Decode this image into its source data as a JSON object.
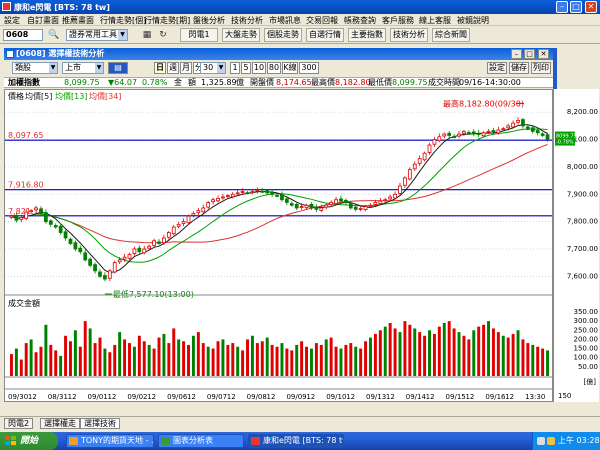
{
  "window": {
    "title": "康和e閃電 [BTS: 78 tw]"
  },
  "menu": [
    "設定",
    "自訂畫面",
    "推薦畫面",
    "行情走勢[個]",
    "行情走勢[期]",
    "盤後分析",
    "技術分析",
    "市場訊息",
    "交易回報",
    "帳務查詢",
    "客戶服務",
    "線上客服",
    "被鏡說明"
  ],
  "toolbar": {
    "stock_code": "0608",
    "tool_select": "證券常用工具",
    "buttons": [
      "閃電1",
      "大盤走勢",
      "個股走勢",
      "自選行情",
      "主要指數",
      "技術分析",
      "綜合新聞"
    ]
  },
  "doc": {
    "title": "[0608] 選擇權技術分析"
  },
  "controls": {
    "category": "類股",
    "market": "上市",
    "period_buttons": [
      "日",
      "週",
      "月",
      "分"
    ],
    "active_period": "日",
    "interval": "30",
    "ranges": [
      "1",
      "5",
      "10",
      "80"
    ],
    "k_label": "K線",
    "count": "300",
    "right_buttons": [
      "設定",
      "儲存",
      "列印"
    ]
  },
  "info": {
    "name": "加權指數",
    "price": "8,099.75",
    "change": "▼64.07",
    "change_pct": "0.78%",
    "amount_label": "金",
    "amount": "額",
    "amount_value": "1,325.89",
    "amount_unit": "億",
    "open_label": "開盤價",
    "open": "8,174.65",
    "high_label": "最高價",
    "high": "8,182.80",
    "low_label": "最低價",
    "low": "8,099.75",
    "time_label": "成交時間",
    "time": "09/16-14:30:00"
  },
  "legend": {
    "price": "價格",
    "ma1": "均價[5]",
    "ma2": "均價[13]",
    "ma3": "均價[34]"
  },
  "colors": {
    "ma5": "#1a1a1a",
    "ma13": "#00a000",
    "ma34": "#e03030",
    "up": "#e00000",
    "down": "#008000",
    "hline": "#0000c0"
  },
  "annotations": {
    "high": "最高8,182.80(09/30)",
    "low": "最低7,577.10(13:00)"
  },
  "hlines": [
    {
      "label": "8,097.65",
      "value": 8097.65
    },
    {
      "label": "7,916.80",
      "value": 7916.8
    },
    {
      "label": "7,821.16",
      "value": 7821.16
    }
  ],
  "price_axis": [
    "8,200.00",
    "8,100.00",
    "8,000.00",
    "7,900.00",
    "7,800.00",
    "7,700.00",
    "7,600.00"
  ],
  "current_price_badge": [
    "8099.75",
    "-0.78%"
  ],
  "volume": {
    "title": "成交金額",
    "axis": [
      "350.00",
      "300.00",
      "250.00",
      "200.00",
      "150.00",
      "100.00",
      "50.00"
    ],
    "unit": "[億]"
  },
  "date_axis": [
    "09/30",
    "12",
    "08/31",
    "12",
    "09/01",
    "12",
    "09/02",
    "12",
    "09/06",
    "12",
    "09/07",
    "12",
    "09/08",
    "12",
    "09/09",
    "12",
    "09/10",
    "12",
    "09/13",
    "12",
    "09/14",
    "12",
    "09/15",
    "12",
    "09/16",
    "12",
    "13:30"
  ],
  "zoom": "150",
  "tabs": [
    "閃電2",
    "選擇權走",
    "選擇技術"
  ],
  "taskbar": {
    "start": "開始",
    "items": [
      "TONY的期貨天地 - ...",
      "圖表分析表",
      "康和e閃電 [BTS: 78 tw]"
    ],
    "clock": "上午 03:28"
  },
  "chart_data": {
    "type": "candlestick",
    "title": "加權指數",
    "ylim": [
      7550,
      8230
    ],
    "x_ticks": [
      "09/30",
      "08/31",
      "09/01",
      "09/02",
      "09/06",
      "09/07",
      "09/08",
      "09/09",
      "09/10",
      "09/13",
      "09/14",
      "09/15",
      "09/16"
    ],
    "close": [
      7820,
      7805,
      7815,
      7835,
      7840,
      7850,
      7830,
      7800,
      7790,
      7780,
      7760,
      7740,
      7720,
      7700,
      7690,
      7660,
      7640,
      7620,
      7600,
      7590,
      7620,
      7650,
      7660,
      7670,
      7680,
      7700,
      7690,
      7700,
      7710,
      7730,
      7720,
      7740,
      7760,
      7780,
      7790,
      7800,
      7820,
      7830,
      7840,
      7850,
      7870,
      7880,
      7885,
      7890,
      7895,
      7900,
      7905,
      7910,
      7905,
      7910,
      7915,
      7910,
      7905,
      7900,
      7895,
      7880,
      7870,
      7860,
      7850,
      7855,
      7860,
      7850,
      7845,
      7850,
      7860,
      7870,
      7880,
      7875,
      7870,
      7850,
      7845,
      7848,
      7855,
      7860,
      7870,
      7875,
      7880,
      7890,
      7900,
      7930,
      7960,
      7990,
      8010,
      8030,
      8050,
      8080,
      8100,
      8110,
      8120,
      8115,
      8110,
      8120,
      8130,
      8125,
      8120,
      8118,
      8125,
      8130,
      8128,
      8135,
      8140,
      8150,
      8160,
      8170,
      8150,
      8140,
      8130,
      8125,
      8115,
      8100
    ],
    "volume_range": [
      0,
      350
    ],
    "volume_sample": [
      120,
      150,
      90,
      180,
      200,
      130,
      160,
      280,
      170,
      140,
      110,
      220,
      190,
      250,
      160,
      300,
      260,
      180,
      210,
      150,
      130,
      170,
      240,
      200,
      180,
      160,
      220,
      190,
      170,
      150,
      210,
      230,
      180,
      260,
      200,
      190,
      170,
      220,
      240,
      180,
      160,
      150,
      190,
      200,
      170,
      180,
      160,
      140,
      200,
      220,
      180,
      190,
      210,
      170,
      160,
      180,
      150,
      140,
      170,
      190,
      160,
      150,
      180,
      170,
      200,
      210,
      160,
      150,
      170,
      180,
      160,
      150,
      190,
      210,
      230,
      250,
      270,
      290,
      260,
      240,
      300,
      280,
      260,
      240,
      220,
      250,
      230,
      270,
      290,
      300,
      260,
      240,
      220,
      200,
      250,
      270,
      280,
      300,
      260,
      240,
      220,
      210,
      230,
      250,
      200,
      180,
      170,
      160,
      150,
      140
    ]
  }
}
